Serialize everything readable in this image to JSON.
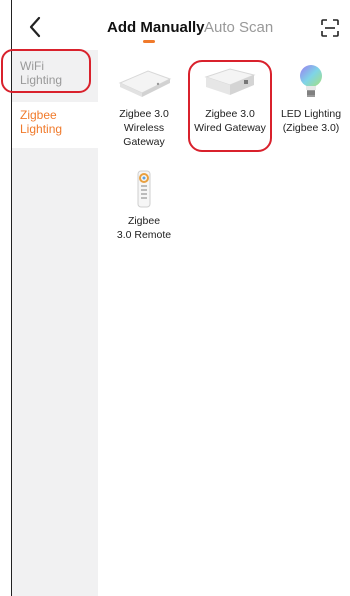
{
  "header": {
    "tabs": [
      {
        "label": "Add Manually",
        "active": true
      },
      {
        "label": "Auto Scan",
        "active": false
      }
    ],
    "back_icon": "chevron-left-icon",
    "scan_icon": "scan-frame-icon"
  },
  "sidebar": {
    "items": [
      {
        "label": "WiFi\nLighting",
        "active": false
      },
      {
        "label": "Zigbee\nLighting",
        "active": true
      }
    ]
  },
  "devices": [
    {
      "label": "Zigbee 3.0\nWireless\nGateway",
      "icon": "wireless-gateway-icon"
    },
    {
      "label": "Zigbee 3.0\nWired Gateway",
      "icon": "wired-gateway-icon"
    },
    {
      "label": "LED Lighting\n(Zigbee 3.0)",
      "icon": "light-bulb-icon"
    },
    {
      "label": "Zigbee\n3.0 Remote",
      "icon": "remote-icon"
    }
  ],
  "colors": {
    "accent": "#f07a2b",
    "highlight": "#d9212c",
    "sidebar_bg": "#f1f1f2"
  }
}
